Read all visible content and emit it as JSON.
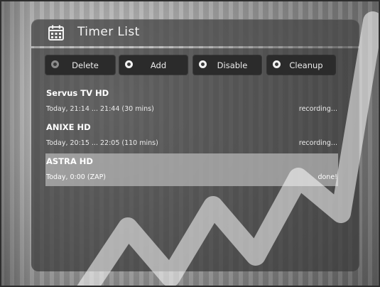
{
  "header": {
    "title": "Timer List",
    "icon": "calendar-icon"
  },
  "buttons": [
    {
      "label": "Delete",
      "ring": "gray"
    },
    {
      "label": "Add",
      "ring": "white"
    },
    {
      "label": "Disable",
      "ring": "white"
    },
    {
      "label": "Cleanup",
      "ring": "white"
    }
  ],
  "timers": [
    {
      "channel": "Servus TV HD",
      "time": "Today, 21:14 ... 21:44 (30 mins)",
      "status": "recording...",
      "selected": false
    },
    {
      "channel": "ANIXE HD",
      "time": "Today, 20:15 ... 22:05 (110 mins)",
      "status": "recording...",
      "selected": false
    },
    {
      "channel": "ASTRA HD",
      "time": "Today, 0:00 (ZAP)",
      "status": "done!",
      "selected": true
    }
  ]
}
